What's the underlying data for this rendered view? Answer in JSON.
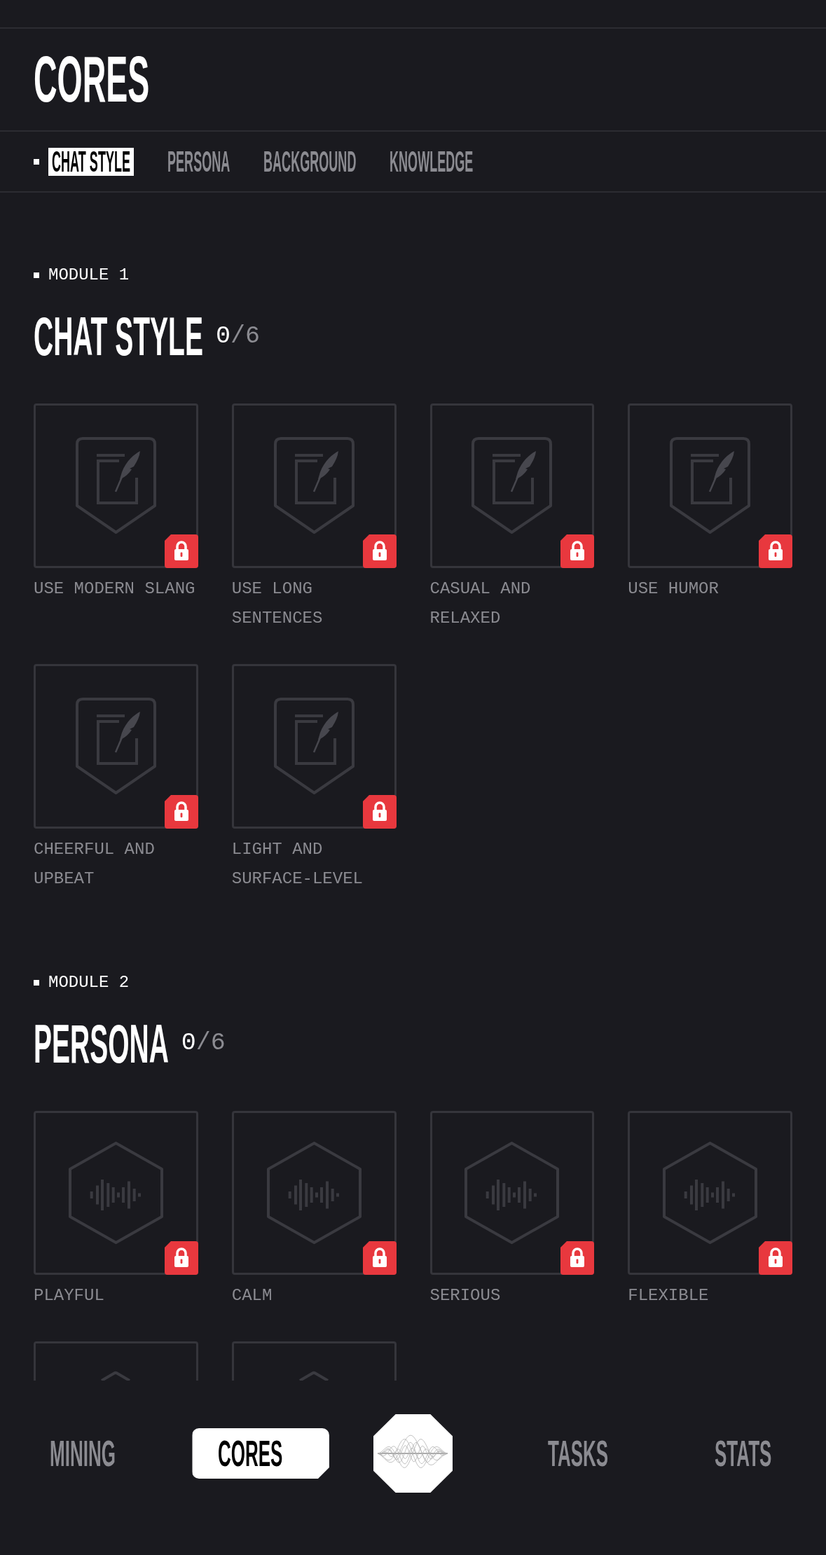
{
  "header": {
    "title": "CORES"
  },
  "tabs": [
    {
      "label": "CHAT STYLE",
      "selected": true
    },
    {
      "label": "PERSONA",
      "selected": false
    },
    {
      "label": "BACKGROUND",
      "selected": false
    },
    {
      "label": "KNOWLEDGE",
      "selected": false
    }
  ],
  "modules": [
    {
      "label": "MODULE 1",
      "title": "CHAT STYLE",
      "done": "0",
      "total": "/6",
      "items": [
        {
          "kind": "tile",
          "label": "USE MODERN SLANG",
          "locked": true
        },
        {
          "kind": "tile",
          "label": "USE LONG SENTENCES",
          "locked": true
        },
        {
          "kind": "tile",
          "label": "CASUAL AND RELAXED",
          "locked": true
        },
        {
          "kind": "tile",
          "label": "USE HUMOR",
          "locked": true
        },
        {
          "kind": "tile",
          "label": "CHEERFUL AND UPBEAT",
          "locked": true
        },
        {
          "kind": "tile",
          "label": "LIGHT AND SURFACE-LEVEL",
          "locked": true
        }
      ]
    },
    {
      "label": "MODULE 2",
      "title": "PERSONA",
      "done": "0",
      "total": "/6",
      "items": [
        {
          "kind": "tile",
          "label": "PLAYFUL",
          "locked": true
        },
        {
          "kind": "tile",
          "label": "CALM",
          "locked": true
        },
        {
          "kind": "tile",
          "label": "SERIOUS",
          "locked": true
        },
        {
          "kind": "tile",
          "label": "FLEXIBLE",
          "locked": true
        },
        {
          "kind": "clipped"
        },
        {
          "kind": "clipped"
        }
      ]
    }
  ],
  "bottom_nav": {
    "tabs": [
      {
        "label": "MINING",
        "selected": false
      },
      {
        "label": "CORES",
        "selected": true
      },
      {
        "label": "TASKS",
        "selected": false
      },
      {
        "label": "STATS",
        "selected": false
      }
    ]
  }
}
